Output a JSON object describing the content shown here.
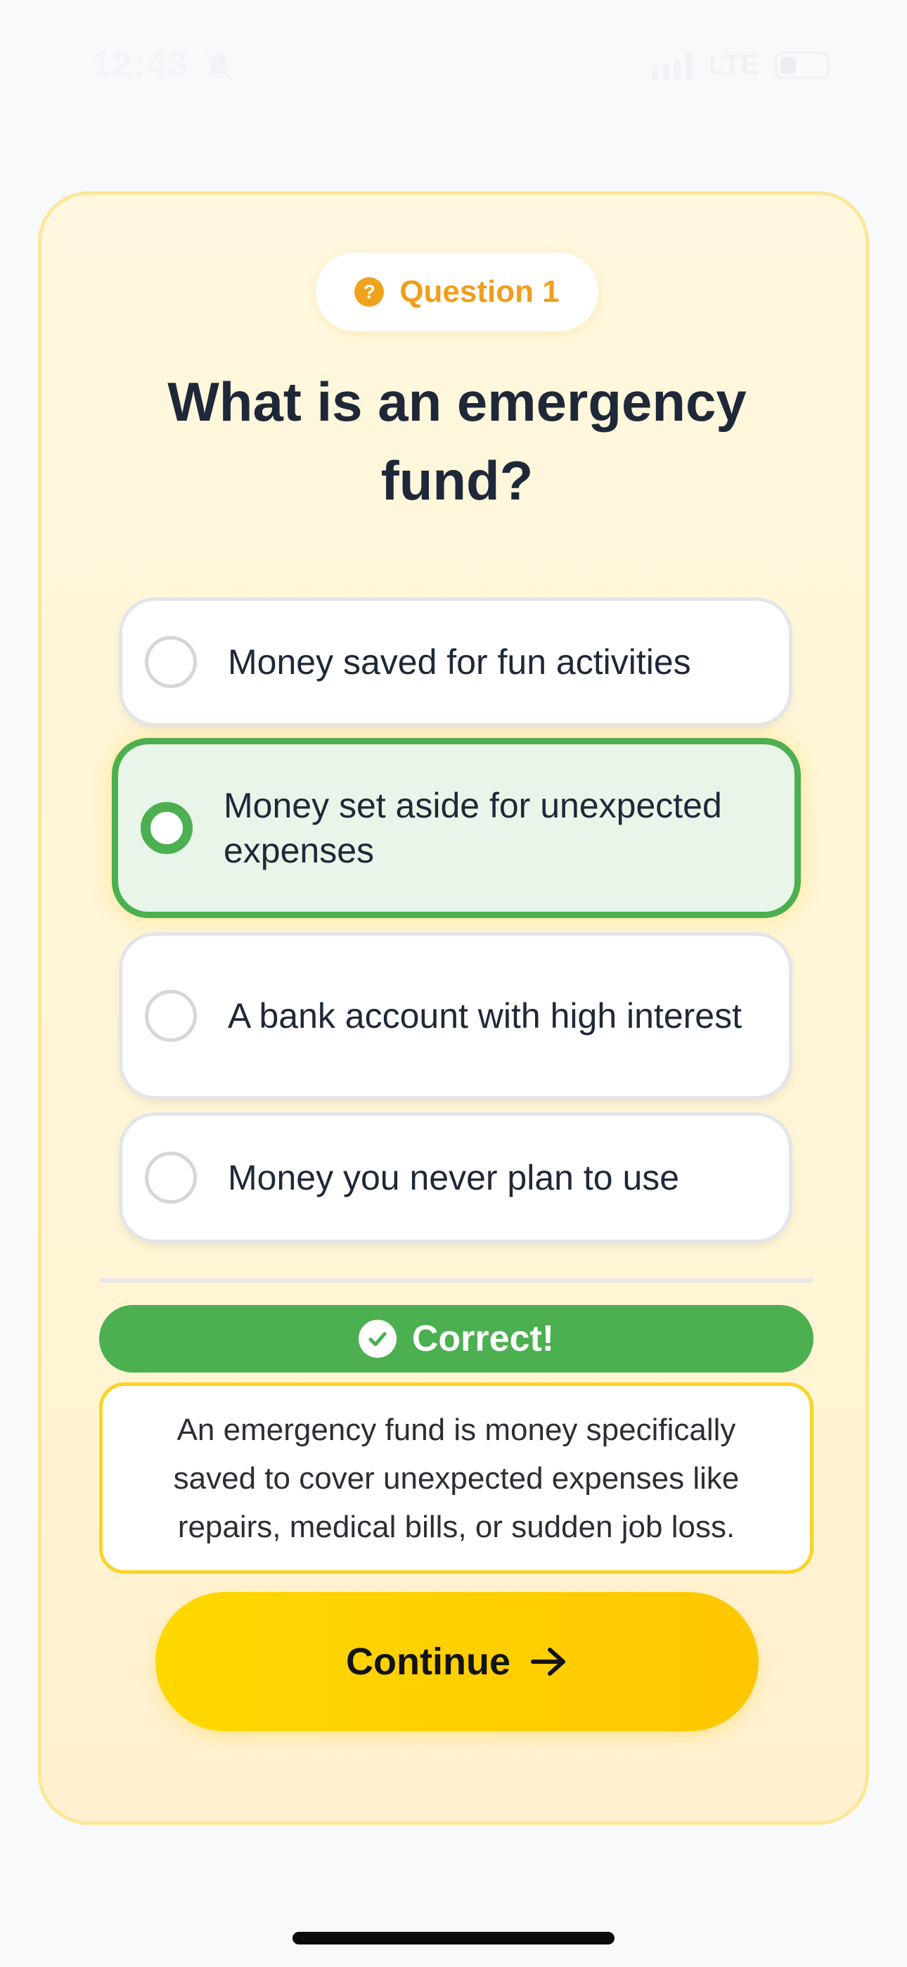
{
  "status_bar": {
    "time": "12:43",
    "network": "LTE",
    "bell_icon": "bell-slash-icon",
    "signal_icon": "signal-bars-icon",
    "battery_icon": "battery-icon"
  },
  "quiz": {
    "question_label": "Question 1",
    "question_icon": "question-circle-icon",
    "question_text": "What is an emergency fund?",
    "options": [
      {
        "label": "Money saved for fun activities",
        "selected": false
      },
      {
        "label": "Money set aside for unexpected expenses",
        "selected": true
      },
      {
        "label": "A bank account with high interest",
        "selected": false
      },
      {
        "label": "Money you never plan to use",
        "selected": false
      }
    ],
    "result": {
      "label": "Correct!",
      "icon": "check-circle-icon",
      "color": "#4caf50"
    },
    "explanation": "An emergency fund is money specifically saved to cover unexpected expenses like repairs, medical bills, or sudden job loss.",
    "continue_label": "Continue",
    "continue_icon": "arrow-right-icon"
  },
  "colors": {
    "accent_yellow": "#ffd200",
    "success_green": "#4caf50",
    "question_orange": "#ef9f1c",
    "title_text": "#1e2838"
  }
}
